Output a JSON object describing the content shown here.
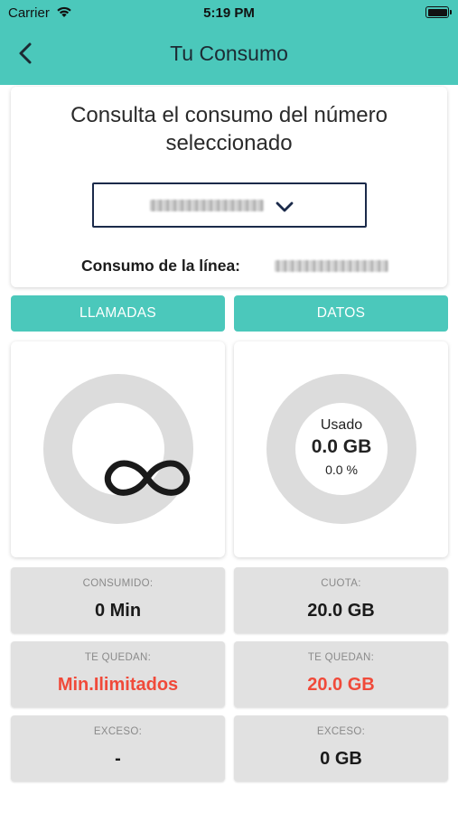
{
  "status_bar": {
    "carrier": "Carrier",
    "time": "5:19 PM"
  },
  "header": {
    "title": "Tu Consumo"
  },
  "selection": {
    "prompt": "Consulta el consumo del número seleccionado",
    "line_label": "Consumo de la línea:"
  },
  "tabs": {
    "calls": "LLAMADAS",
    "data": "DATOS"
  },
  "data_gauge": {
    "used_label": "Usado",
    "used_value": "0.0 GB",
    "used_percent": "0.0 %",
    "fill_fraction": 0
  },
  "calls_stats": [
    {
      "label": "CONSUMIDO:",
      "value": "0 Min"
    },
    {
      "label": "TE QUEDAN:",
      "value": "Min.Ilimitados"
    },
    {
      "label": "EXCESO:",
      "value": "-"
    }
  ],
  "data_stats": [
    {
      "label": "CUOTA:",
      "value": "20.0 GB"
    },
    {
      "label": "TE QUEDAN:",
      "value": "20.0 GB"
    },
    {
      "label": "EXCESO:",
      "value": "0 GB"
    }
  ],
  "colors": {
    "accent": "#4bc8bb",
    "alert": "#f04a3a",
    "ring": "#dcdcdc",
    "stat_bg": "#e1e1e1"
  },
  "icons": [
    "wifi-icon",
    "battery-icon",
    "back-arrow-icon",
    "chevron-down-icon",
    "infinity-icon"
  ]
}
